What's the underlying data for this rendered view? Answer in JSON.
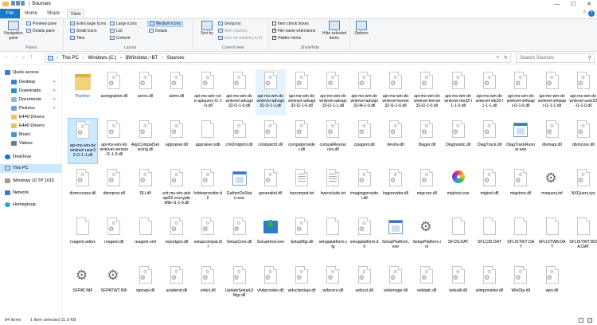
{
  "titlebar": {
    "title": "Sources",
    "minimize_glyph": "—",
    "maximize_glyph": "☐",
    "close_glyph": "✕"
  },
  "ribbon_tabs": [
    "File",
    "Home",
    "Share",
    "View"
  ],
  "ribbon": {
    "panes": {
      "label": "Panes",
      "navigation_pane": "Navigation pane",
      "preview_pane": "Preview pane",
      "details_pane": "Details pane"
    },
    "layout": {
      "label": "Layout",
      "extra_large_icons": "Extra large icons",
      "large_icons": "Large icons",
      "medium_icons": "Medium icons",
      "small_icons": "Small icons",
      "list": "List",
      "details": "Details",
      "tiles": "Tiles",
      "content": "Content"
    },
    "current_view": {
      "label": "Current view",
      "sort_by": "Sort by",
      "group_by": "Group by",
      "add_columns": "Add columns",
      "size_all_columns": "Size all columns to fit"
    },
    "show_hide": {
      "label": "Show/hide",
      "item_check_boxes": "Item check boxes",
      "file_name_extensions": "File name extensions",
      "hidden_items": "Hidden items",
      "hide_selected_items": "Hide selected items"
    },
    "options": {
      "label": "Options"
    }
  },
  "address": {
    "crumbs": [
      "This PC",
      "Windows (C:)",
      "$Windows.~BT",
      "Sources"
    ],
    "search_placeholder": "Search Sources"
  },
  "nav": {
    "items": [
      {
        "label": "Quick access"
      },
      {
        "label": "Desktop"
      },
      {
        "label": "Downloads"
      },
      {
        "label": "Documents"
      },
      {
        "label": "Pictures"
      },
      {
        "label": "E440 Drivers"
      },
      {
        "label": "E440 Drivers"
      },
      {
        "label": "Music"
      },
      {
        "label": "Videos"
      },
      {
        "label": "OneDrive"
      },
      {
        "label": "This PC"
      },
      {
        "label": "Windows 10 TP 1015"
      },
      {
        "label": "Network"
      },
      {
        "label": "Homegroup"
      }
    ]
  },
  "files": [
    {
      "name": "Panther",
      "icon": "folder"
    },
    {
      "name": "acmigration.dll",
      "icon": "dll"
    },
    {
      "name": "acres.dll",
      "icon": "dll"
    },
    {
      "name": "aeinv.dll",
      "icon": "dll"
    },
    {
      "name": "api-ms-win-core-apiquery-l1-1-0.dll",
      "icon": "dll"
    },
    {
      "name": "api-ms-win-downlevel-advapi32-l1-1-0.dll",
      "icon": "dll"
    },
    {
      "name": "api-ms-win-downlevel-advapi32-l1-1-1.dll",
      "icon": "dll"
    },
    {
      "name": "api-ms-win-downlevel-advapi32-l2-1-0.dll",
      "icon": "dll"
    },
    {
      "name": "api-ms-win-downlevel-advapi32-l2-1-1.dll",
      "icon": "dll"
    },
    {
      "name": "api-ms-win-downlevel-advapi32-l4-1-0.dll",
      "icon": "dll"
    },
    {
      "name": "api-ms-win-downlevel-kernel32-l1-1-0.dll",
      "icon": "dll"
    },
    {
      "name": "api-ms-win-downlevel-kernel32-l2-1-0.dll",
      "icon": "dll"
    },
    {
      "name": "api-ms-win-downlevel-ole32-l1-1-0.dll",
      "icon": "dll"
    },
    {
      "name": "api-ms-win-downlevel-ole32-l1-1-1.dll",
      "icon": "dll"
    },
    {
      "name": "api-ms-win-downlevel-shlwapi-l1-1-0.dll",
      "icon": "dll"
    },
    {
      "name": "api-ms-win-downlevel-shlwapi-l1-1-1.dll",
      "icon": "dll"
    },
    {
      "name": "api-ms-win-downlevel-user32-l1-1-0.dll",
      "icon": "dll"
    },
    {
      "name": "api-ms-win-downlevel-user32-l1-1-1.dll",
      "icon": "dll"
    },
    {
      "name": "api-ms-win-downlevel-version-l1-1-0.dll",
      "icon": "dll"
    },
    {
      "name": "AppCompatServicing.dll",
      "icon": "dll"
    },
    {
      "name": "appraiser.dll",
      "icon": "dll"
    },
    {
      "name": "appraiser.sdb",
      "icon": "blank"
    },
    {
      "name": "cmi2migxml.dll",
      "icon": "dll"
    },
    {
      "name": "compatctrl.dll",
      "icon": "dll"
    },
    {
      "name": "compatprovider.dll",
      "icon": "dll"
    },
    {
      "name": "compatResources.dll",
      "icon": "dll"
    },
    {
      "name": "csiagent.dll",
      "icon": "dll"
    },
    {
      "name": "devinv.dll",
      "icon": "dll"
    },
    {
      "name": "Diager.dll",
      "icon": "dll"
    },
    {
      "name": "Diagnostic.dll",
      "icon": "dll"
    },
    {
      "name": "DiagTrack.dll",
      "icon": "dll"
    },
    {
      "name": "DiagTrackRunner.exe",
      "icon": "exewin"
    },
    {
      "name": "dismapi.dll",
      "icon": "dll"
    },
    {
      "name": "dismcore.dll",
      "icon": "dll"
    },
    {
      "name": "dismcoreps.dll",
      "icon": "dll"
    },
    {
      "name": "dismprov.dll",
      "icon": "dll"
    },
    {
      "name": "DU.dll",
      "icon": "dll"
    },
    {
      "name": "ext-ms-win-advapi32-encryptedfile-l1-1-0.dll",
      "icon": "dll"
    },
    {
      "name": "folderprovider.dll",
      "icon": "dll"
    },
    {
      "name": "GatherOsState.exe",
      "icon": "exewin"
    },
    {
      "name": "generaltel.dll",
      "icon": "dll"
    },
    {
      "name": "hwcompat.txt",
      "icon": "txt"
    },
    {
      "name": "hwexclude.txt",
      "icon": "txt"
    },
    {
      "name": "imagingprovider.dll",
      "icon": "dll"
    },
    {
      "name": "logprovider.dll",
      "icon": "dll"
    },
    {
      "name": "migcore.dll",
      "icon": "dll"
    },
    {
      "name": "mighost.exe",
      "icon": "exedisc"
    },
    {
      "name": "migisol.dll",
      "icon": "dll"
    },
    {
      "name": "migstore.dll",
      "icon": "dll"
    },
    {
      "name": "mxquery.inf",
      "icon": "exegear"
    },
    {
      "name": "NXQuery.sys",
      "icon": "dll"
    },
    {
      "name": "reagent.admx",
      "icon": "blank"
    },
    {
      "name": "reagent.dll",
      "icon": "dll"
    },
    {
      "name": "reagent.xml",
      "icon": "blank"
    },
    {
      "name": "reportgen.dll",
      "icon": "dll"
    },
    {
      "name": "setupcompat.dll",
      "icon": "dll"
    },
    {
      "name": "SetupCore.dll",
      "icon": "dll"
    },
    {
      "name": "SetupHost.exe",
      "icon": "exegreen"
    },
    {
      "name": "SetupMgr.dll",
      "icon": "dll"
    },
    {
      "name": "setupplatform.cfg",
      "icon": "blank"
    },
    {
      "name": "setupplatform.dll",
      "icon": "dll"
    },
    {
      "name": "SetupPlatform.exe",
      "icon": "exewin"
    },
    {
      "name": "SetupPlatform.ini",
      "icon": "exegear"
    },
    {
      "name": "SFCN.DAT",
      "icon": "blank"
    },
    {
      "name": "SFLCID.DAT",
      "icon": "blank"
    },
    {
      "name": "SFLISTW7.DAT",
      "icon": "blank"
    },
    {
      "name": "SFLISTW8.DAT",
      "icon": "blank"
    },
    {
      "name": "SFLISTWT.WOA.DAT",
      "icon": "blank"
    },
    {
      "name": "SFPAT.INF",
      "icon": "exegear"
    },
    {
      "name": "SFPATWT.INF",
      "icon": "exegear"
    },
    {
      "name": "sqmapi.dll",
      "icon": "dll"
    },
    {
      "name": "unattend.dll",
      "icon": "dll"
    },
    {
      "name": "unbcl.dll",
      "icon": "dll"
    },
    {
      "name": "UpdateSetupUIMgr.dll",
      "icon": "dll"
    },
    {
      "name": "vhdprovider.dll",
      "icon": "dll"
    },
    {
      "name": "wdsclientapi.dll",
      "icon": "dll"
    },
    {
      "name": "wdscore.dll",
      "icon": "dll"
    },
    {
      "name": "wdscsl.dll",
      "icon": "dll"
    },
    {
      "name": "wdsimage.dll",
      "icon": "dll"
    },
    {
      "name": "wdstptc.dll",
      "icon": "dll"
    },
    {
      "name": "wdsutil.dll",
      "icon": "dll"
    },
    {
      "name": "wimprovider.dll",
      "icon": "dll"
    },
    {
      "name": "WinDlp.dll",
      "icon": "dll"
    },
    {
      "name": "wpx.dll",
      "icon": "dll"
    }
  ],
  "selected_file": "api-ms-win-downlevel-user32-l1-1-1.dll",
  "hovered_file": "api-ms-win-downlevel-advapi32-l1-1-1.dll",
  "status": {
    "count": "84 items",
    "selection": "1 item selected  11.9 KB"
  }
}
